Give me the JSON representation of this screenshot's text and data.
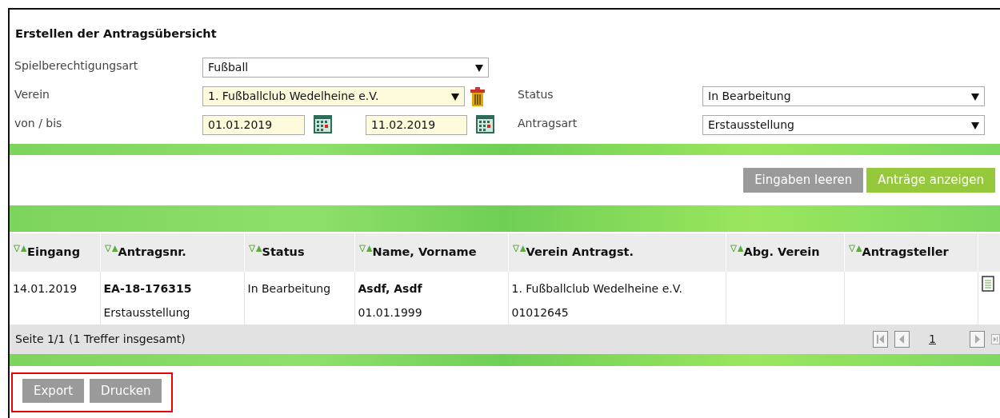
{
  "title": "Erstellen der Antragsübersicht",
  "filters": [
    {
      "label": "Spielberechtigungsart",
      "controls": [
        {
          "kind": "select",
          "value": "Fußball",
          "highlighted": false
        }
      ]
    },
    {
      "label": "Verein",
      "controls": [
        {
          "kind": "select",
          "value": "1. Fußballclub Wedelheine e.V.",
          "highlighted": true
        },
        {
          "kind": "clear"
        }
      ]
    },
    {
      "label": "von / bis",
      "controls": [
        {
          "kind": "date",
          "value": "01.01.2019",
          "highlighted": true
        },
        {
          "kind": "date",
          "value": "11.02.2019",
          "highlighted": true
        }
      ]
    }
  ],
  "side_filters": [
    {
      "label": "Status",
      "value": "In Bearbeitung"
    },
    {
      "label": "Antragsart",
      "value": "Erstausstellung"
    }
  ],
  "buttons": [
    {
      "label": "Eingaben leeren",
      "kind": "secondary"
    },
    {
      "label": "Anträge anzeigen",
      "kind": "primary"
    }
  ],
  "table": {
    "columns": [
      "Eingang",
      "Antragsnr.",
      "Status",
      "Name, Vorname",
      "Verein Antragst.",
      "Abg. Verein",
      "Antragsteller"
    ],
    "rows": [
      {
        "cells": [
          {
            "lines": [
              {
                "text": "14.01.2019",
                "bold": false
              }
            ]
          },
          {
            "lines": [
              {
                "text": "EA-18-176315",
                "bold": true
              },
              {
                "text": "Erstausstellung",
                "bold": false
              }
            ]
          },
          {
            "lines": [
              {
                "text": "In Bearbeitung",
                "bold": false
              }
            ]
          },
          {
            "lines": [
              {
                "text": "Asdf, Asdf",
                "bold": true
              },
              {
                "text": "01.01.1999",
                "bold": false
              }
            ]
          },
          {
            "lines": [
              {
                "text": "1. Fußballclub Wedelheine e.V.",
                "bold": false
              },
              {
                "text": "01012645",
                "bold": false
              }
            ]
          },
          {},
          {}
        ],
        "document": true
      }
    ],
    "footer": "Seite 1/1 (1 Treffer insgesamt)",
    "pager": {
      "current": "1"
    }
  },
  "bottom_actions": {
    "highlighted": true,
    "buttons": [
      "Export",
      "Drucken"
    ]
  }
}
